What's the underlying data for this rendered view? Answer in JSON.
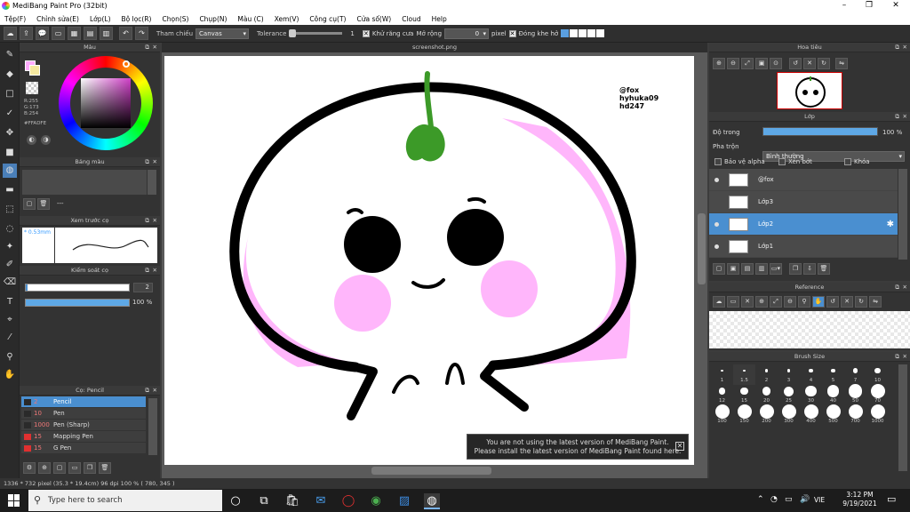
{
  "window": {
    "title": "MediBang Paint Pro (32bit)"
  },
  "menu": [
    "Tệp(F)",
    "Chỉnh sửa(E)",
    "Lớp(L)",
    "Bộ lọc(R)",
    "Chọn(S)",
    "Chụp(N)",
    "Màu (C)",
    "Xem(V)",
    "Công cụ(T)",
    "Cửa số(W)",
    "Cloud",
    "Help"
  ],
  "toolbar": {
    "ref_label": "Tham chiếu",
    "ref_value": "Canvas",
    "tolerance_label": "Tolerance",
    "tolerance_value": "1",
    "antialias_label": "Khử răng cưa",
    "expand_label": "Mở rộng",
    "expand_value": "0",
    "pixel_label": "pixel",
    "close_gap_label": "Đóng khe hở"
  },
  "color_panel": {
    "title": "Màu",
    "r": "R:255",
    "g": "G:173",
    "b": "B:254",
    "hex": "#FFADFE",
    "primary": "#FFADFE"
  },
  "palette_panel": {
    "title": "Bảng màu",
    "value": "---"
  },
  "preview_panel": {
    "title": "Xem trước cọ",
    "size": "0.53mm"
  },
  "brush_control": {
    "title": "Kiểm soát cọ",
    "size": "2",
    "opacity": "100 %"
  },
  "brush_list": {
    "title": "Cọ: Pencil",
    "items": [
      {
        "size": "2",
        "name": "Pencil",
        "color": "#2a2a2a",
        "active": true
      },
      {
        "size": "10",
        "name": "Pen",
        "color": "#2a2a2a"
      },
      {
        "size": "1000",
        "name": "Pen (Sharp)",
        "color": "#2a2a2a"
      },
      {
        "size": "15",
        "name": "Mapping Pen",
        "color": "#e03030"
      },
      {
        "size": "15",
        "name": "G Pen",
        "color": "#e03030"
      }
    ]
  },
  "canvas": {
    "tab": "screenshot.png",
    "watermark_lines": [
      "@fox",
      "hyhuka09",
      "hd247"
    ]
  },
  "notification": {
    "line1": "You are not using the latest version of MediBang Paint.",
    "line2": "Please install the latest version of MediBang Paint found here."
  },
  "navigator_panel": {
    "title": "Hoa tiêu"
  },
  "layer_panel": {
    "title": "Lớp",
    "opacity_label": "Độ trong",
    "opacity_value": "100 %",
    "opacity": 1.0,
    "blend_label": "Pha trộn",
    "blend_value": "Bình thường",
    "protect_alpha": "Bảo vệ alpha",
    "clipping": "Xén bớt",
    "lock": "Khóa",
    "layers": [
      {
        "name": "@fox",
        "active": false
      },
      {
        "name": "Lớp3",
        "active": false
      },
      {
        "name": "Lớp2",
        "active": true
      },
      {
        "name": "Lớp1",
        "active": false
      }
    ]
  },
  "reference_panel": {
    "title": "Reference"
  },
  "brush_size_panel": {
    "title": "Brush Size",
    "sizes": [
      "1",
      "1.5",
      "2",
      "3",
      "4",
      "5",
      "7",
      "10",
      "12",
      "15",
      "20",
      "25",
      "30",
      "40",
      "50",
      "70",
      "100",
      "150",
      "200",
      "300",
      "400",
      "500",
      "700",
      "1000"
    ]
  },
  "status": {
    "text": "1336 * 732 pixel   (35.3 * 19.4cm)  96 dpi   100 %   ( 780, 345 )"
  },
  "taskbar": {
    "search": "Type here to search",
    "lang": "VIE",
    "time": "3:12 PM",
    "date": "9/19/2021"
  }
}
